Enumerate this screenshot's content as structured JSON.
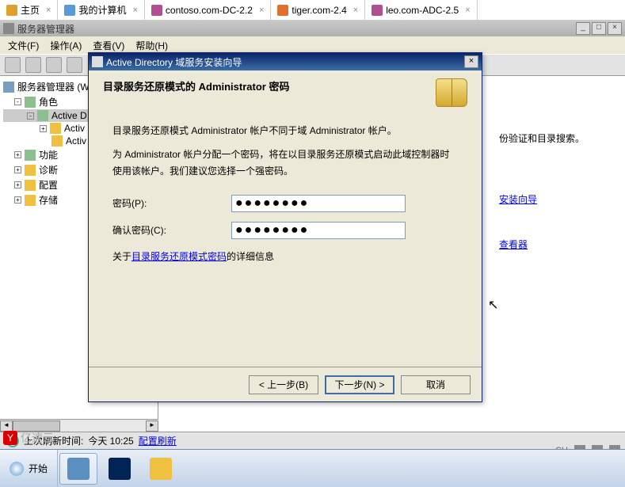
{
  "browser_tabs": [
    {
      "label": "主页",
      "icon_color": "#e0a030"
    },
    {
      "label": "我的计算机",
      "icon_color": "#5b9bd5"
    },
    {
      "label": "contoso.com-DC-2.2",
      "icon_color": "#b05090"
    },
    {
      "label": "tiger.com-2.4",
      "icon_color": "#e07030",
      "active": true
    },
    {
      "label": "leo.com-ADC-2.5",
      "icon_color": "#b05090"
    }
  ],
  "main_window": {
    "title": "服务器管理器",
    "menu": [
      "文件(F)",
      "操作(A)",
      "查看(V)",
      "帮助(H)"
    ]
  },
  "tree": {
    "root": "服务器管理器 (W",
    "nodes": [
      {
        "label": "角色",
        "indent": 1,
        "exp": "-"
      },
      {
        "label": "Active D",
        "indent": 2,
        "exp": "-",
        "sel": true
      },
      {
        "label": "Activ",
        "indent": 3,
        "exp": "+"
      },
      {
        "label": "Activ",
        "indent": 3,
        "exp": ""
      },
      {
        "label": "功能",
        "indent": 1,
        "exp": "+"
      },
      {
        "label": "诊断",
        "indent": 1,
        "exp": "+"
      },
      {
        "label": "配置",
        "indent": 1,
        "exp": "+"
      },
      {
        "label": "存储",
        "indent": 1,
        "exp": "+"
      }
    ]
  },
  "content": {
    "heading_fragment": "份验证和目录搜索。",
    "link1": "安装向导",
    "link2": "查看器"
  },
  "dialog": {
    "title": "Active Directory 域服务安装向导",
    "heading": "目录服务还原模式的 Administrator 密码",
    "para1": "目录服务还原模式 Administrator 帐户不同于域 Administrator 帐户。",
    "para2": "为 Administrator 帐户分配一个密码，将在以目录服务还原模式启动此域控制器时使用该帐户。我们建议您选择一个强密码。",
    "label_password": "密码(P):",
    "label_confirm": "确认密码(C):",
    "password_mask": "●●●●●●●●",
    "confirm_mask": "●●●●●●●●",
    "info_prefix": "关于",
    "info_link": "目录服务还原模式密码",
    "info_suffix": "的详细信息",
    "btn_back": "< 上一步(B)",
    "btn_next": "下一步(N) >",
    "btn_cancel": "取消"
  },
  "statusbar": {
    "refresh_label": "上次刷新时间:",
    "time": "今天 10:25",
    "action": "配置刷新"
  },
  "taskbar": {
    "start": "开始"
  },
  "tray": {
    "lang": "CH",
    "ime": "▦"
  },
  "watermark": "亿速云"
}
